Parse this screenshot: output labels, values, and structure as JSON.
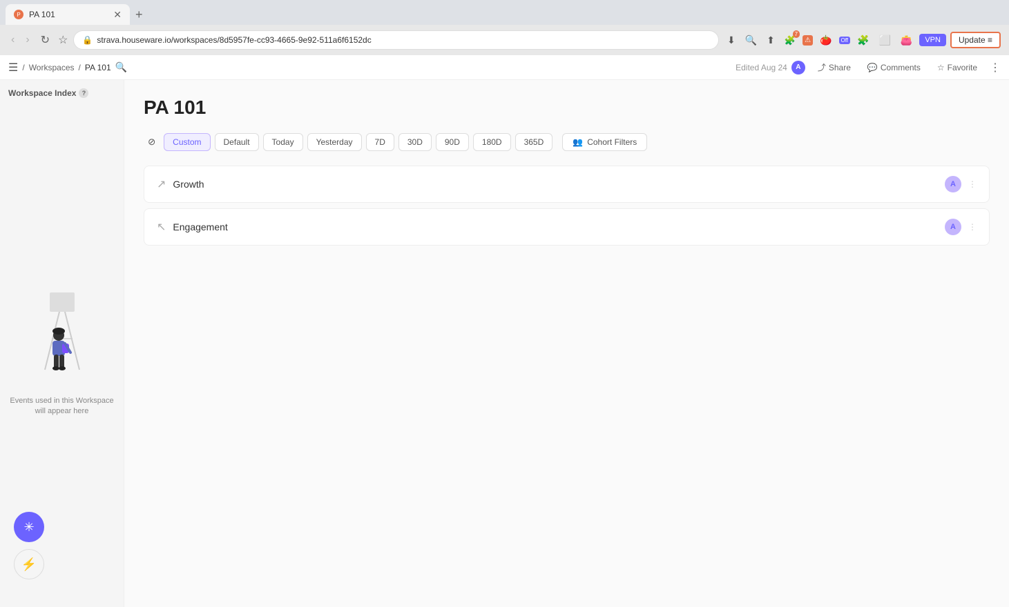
{
  "browser": {
    "tab_title": "PA 101",
    "url": "strava.houseware.io/workspaces/8d5957fe-cc93-4665-9e92-511a6f6152dc",
    "tab_favicon_text": "P",
    "new_tab_label": "+",
    "update_btn": "Update ≡"
  },
  "breadcrumb": {
    "menu_icon": "☰",
    "workspaces_label": "Workspaces",
    "separator1": "/",
    "current_label": "PA 101",
    "separator2": "/",
    "search_icon": "🔍",
    "edited_label": "Edited Aug 24",
    "avatar_letter": "A",
    "share_label": "Share",
    "comments_label": "Comments",
    "favorite_label": "Favorite",
    "more_icon": "⋮"
  },
  "sidebar": {
    "title": "Workspace Index",
    "help_icon": "?",
    "empty_text": "Events used in this Workspace\nwill appear here"
  },
  "page": {
    "title": "PA 101"
  },
  "filter_bar": {
    "filter_icon": "⊘",
    "custom_label": "Custom",
    "default_label": "Default",
    "today_label": "Today",
    "yesterday_label": "Yesterday",
    "7d_label": "7D",
    "30d_label": "30D",
    "90d_label": "90D",
    "180d_label": "180D",
    "365d_label": "365D",
    "cohort_icon": "👥",
    "cohort_label": "Cohort Filters"
  },
  "sections": [
    {
      "id": "growth",
      "icon": "↗",
      "label": "Growth",
      "avatar_letter": "A"
    },
    {
      "id": "engagement",
      "icon": "↖",
      "label": "Engagement",
      "avatar_letter": "A"
    }
  ],
  "fabs": {
    "primary_icon": "✳",
    "secondary_icon": "⚡"
  }
}
